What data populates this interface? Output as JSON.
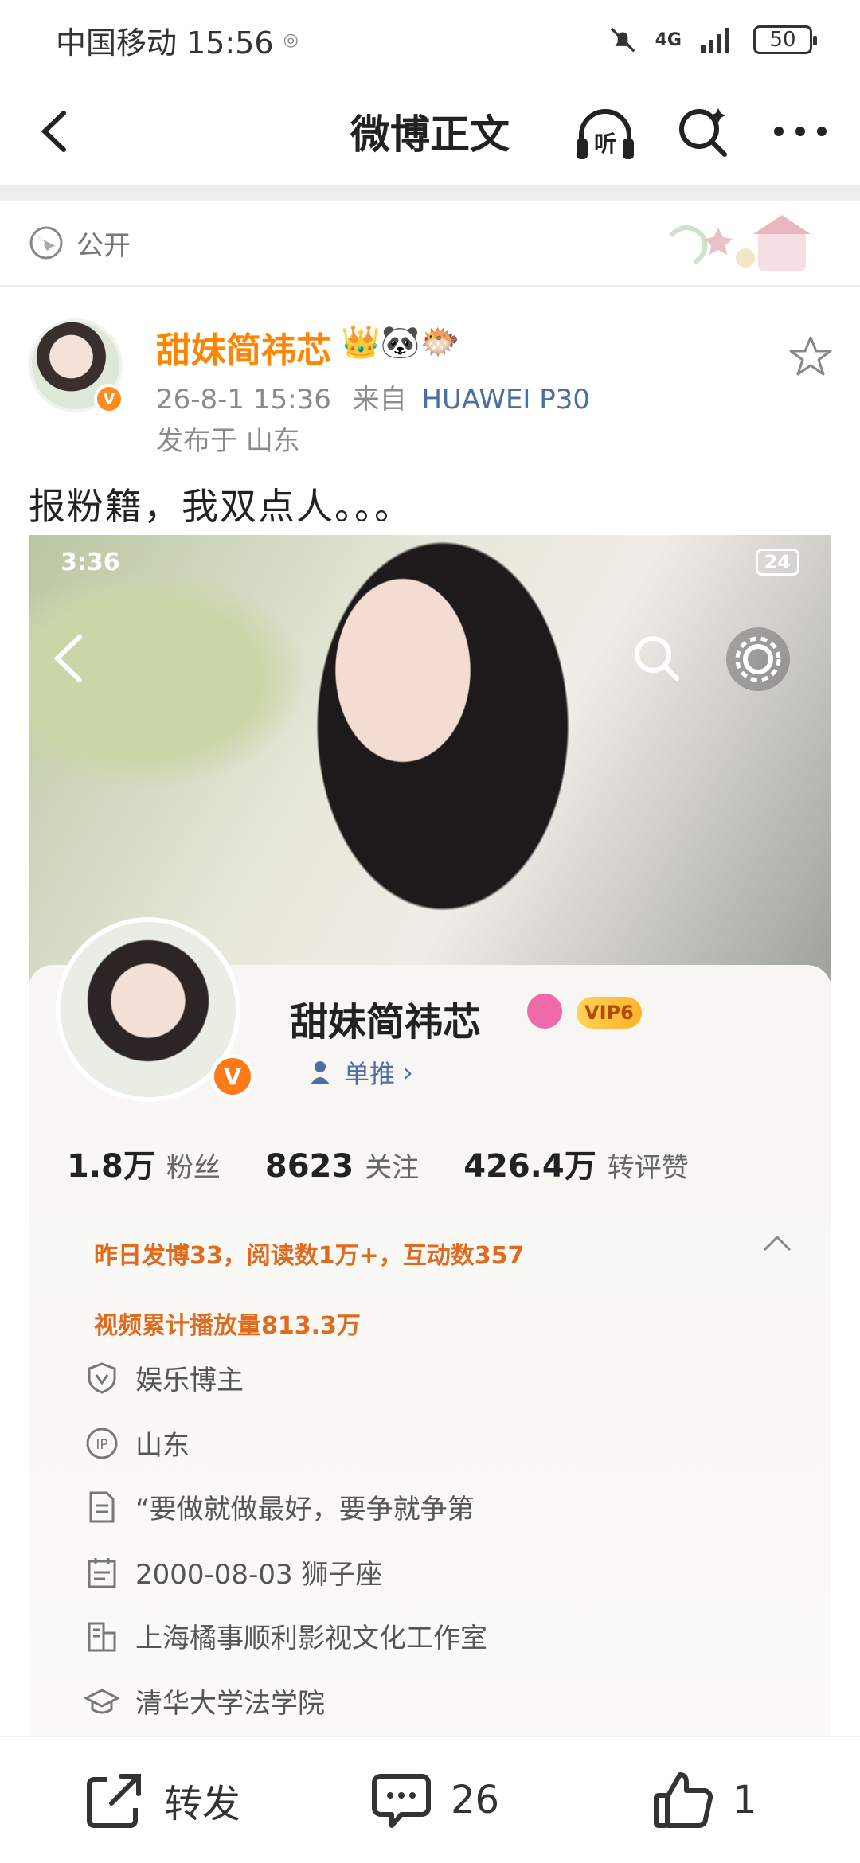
{
  "status_bar": {
    "carrier_time": "中国移动 15:56",
    "network": "4G",
    "battery": "50"
  },
  "nav": {
    "title": "微博正文",
    "listen_label": "听"
  },
  "visibility": {
    "label": "公开"
  },
  "post": {
    "author": "甜妹简祎芯",
    "author_emojis": "👑🐼🐡",
    "timestamp": "26-8-1 15:36",
    "source_prefix": "来自",
    "device": "HUAWEI P30",
    "location": "发布于 山东",
    "text": "报粉籍，我双点人。。。"
  },
  "screenshot": {
    "status_time": "3:36",
    "status_right": "24",
    "name": "甜妹简祎芯",
    "vip": "VIP6",
    "single_push": "单推",
    "stats": [
      {
        "value": "1.8万",
        "label": "粉丝"
      },
      {
        "value": "8623",
        "label": "关注"
      },
      {
        "value": "426.4万",
        "label": "转评赞"
      }
    ],
    "line1": "昨日发博33，阅读数1万+，互动数357",
    "line2": "视频累计播放量813.3万",
    "info": [
      {
        "icon": "shield-v-icon",
        "text": "娱乐博主"
      },
      {
        "icon": "ip-icon",
        "text": "山东"
      },
      {
        "icon": "document-icon",
        "text": "“要做就做最好，要争就争第"
      },
      {
        "icon": "calendar-icon",
        "text": "2000-08-03 狮子座"
      },
      {
        "icon": "building-icon",
        "text": "上海橘事顺利影视文化工作室"
      },
      {
        "icon": "graduation-cap-icon",
        "text": "清华大学法学院"
      }
    ]
  },
  "actions": {
    "repost": "转发",
    "comments": "26",
    "likes": "1"
  }
}
